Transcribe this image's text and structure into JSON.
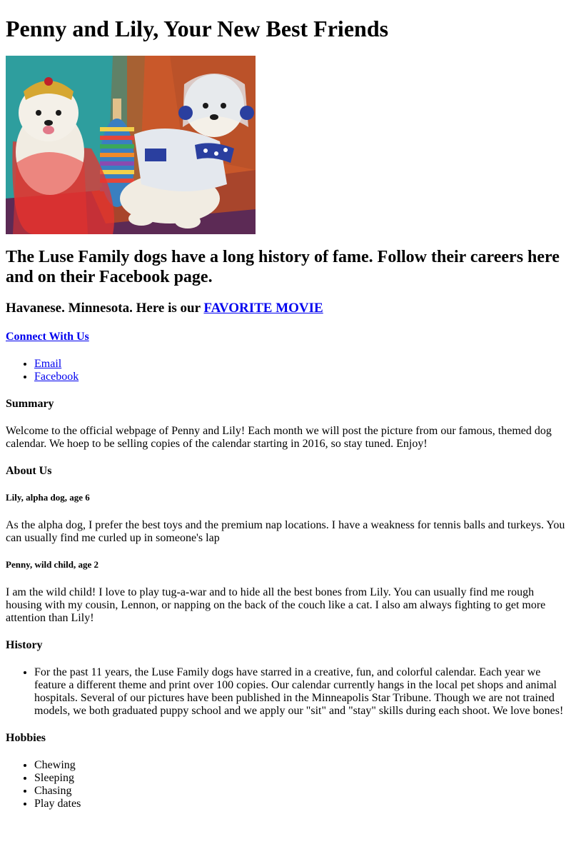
{
  "page_title": "Penny and Lily, Your New Best Friends",
  "hero_image": {
    "alt": "Penny and Lily in costume",
    "colors": {
      "teal": "#2e9e9e",
      "orange": "#c9582a",
      "rust": "#a8452c",
      "purple": "#5c2a55",
      "red_veil": "#e8332d",
      "gold": "#d6a732",
      "fur": "#f1ece2",
      "spacesuit": "#e4e8ee",
      "blue": "#2a3f9f"
    }
  },
  "intro_heading": "The Luse Family dogs have a long history of fame. Follow their careers here and on their Facebook page.",
  "breed_line": {
    "prefix": "Havanese. Minnesota. Here is our ",
    "link": "FAVORITE MOVIE"
  },
  "connect": {
    "heading_link": "Connect With Us",
    "items": [
      "Email",
      "Facebook"
    ]
  },
  "summary": {
    "heading": "Summary",
    "text": "Welcome to the official webpage of Penny and Lily! Each month we will post the picture from our famous, themed dog calendar. We hoep to be selling copies of the calendar starting in 2016, so stay tuned. Enjoy!"
  },
  "about": {
    "heading": "About Us",
    "lily": {
      "heading": "Lily, alpha dog, age 6",
      "text": "As the alpha dog, I prefer the best toys and the premium nap locations. I have a weakness for tennis balls and turkeys. You can usually find me curled up in someone's lap"
    },
    "penny": {
      "heading": "Penny, wild child, age 2",
      "text": "I am the wild child! I love to play tug-a-war and to hide all the best bones from Lily. You can usually find me rough housing with my cousin, Lennon, or napping on the back of the couch like a cat. I also am always fighting to get more attention than Lily!"
    }
  },
  "history": {
    "heading": "History",
    "items": [
      "For the past 11 years, the Luse Family dogs have starred in a creative, fun, and colorful calendar. Each year we feature a different theme and print over 100 copies. Our calendar currently hangs in the local pet shops and animal hospitals. Several of our pictures have been published in the Minneapolis Star Tribune. Though we are not trained models, we both graduated puppy school and we apply our \"sit\" and \"stay\" skills during each shoot. We love bones!"
    ]
  },
  "hobbies": {
    "heading": "Hobbies",
    "items": [
      "Chewing",
      "Sleeping",
      "Chasing",
      "Play dates"
    ]
  }
}
